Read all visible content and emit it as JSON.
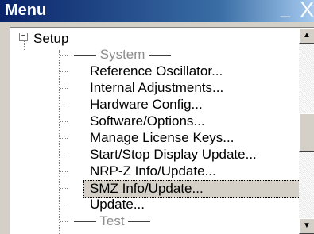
{
  "window": {
    "title": "Menu",
    "minimize_glyph": "_",
    "close_glyph": "X"
  },
  "tree": {
    "root_label": "Setup",
    "expander_glyph": "−",
    "section_system": "System",
    "items": [
      "Reference Oscillator...",
      "Internal Adjustments...",
      "Hardware Config...",
      "Software/Options...",
      "Manage License Keys...",
      "Start/Stop Display Update...",
      "NRP-Z Info/Update...",
      "SMZ Info/Update...",
      "Update..."
    ],
    "selected_index": 7,
    "section_test": "Test"
  },
  "scrollbar": {
    "up_glyph": "▲",
    "down_glyph": "▼"
  }
}
